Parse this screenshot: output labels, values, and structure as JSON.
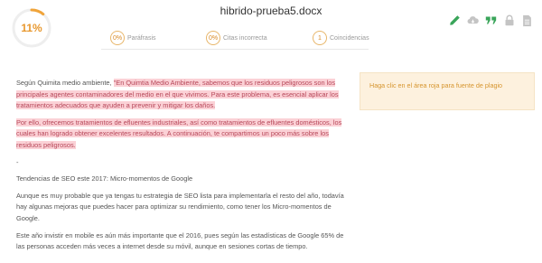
{
  "score": {
    "value": "11%",
    "ring_color": "#f0a43a",
    "fraction": 0.11
  },
  "document": {
    "title": "hibrido-prueba5.docx"
  },
  "stats": [
    {
      "value": "0%",
      "label": "Paráfrasis"
    },
    {
      "value": "0%",
      "label": "Citas incorrecta"
    },
    {
      "value": "1",
      "label": "Coincidencias"
    }
  ],
  "toolbar": {
    "icons": [
      "edit-icon",
      "cloud-download-icon",
      "quote-icon",
      "lock-icon",
      "document-icon"
    ],
    "colors": {
      "active": "#3aa55a",
      "inactive": "#c4c4c4"
    }
  },
  "side_note": {
    "text": "Haga clic en el área roja para fuente de plagio"
  },
  "body": {
    "p1_plain": "Según Quimita medio ambiente, ",
    "p1_highlight": "\"En Quimtia Medio Ambiente, sabemos que los residuos peligrosos son los principales agentes contaminadores del medio en el que vivimos. Para este problema, es esencial aplicar los tratamientos adecuados que ayuden a prevenir y mitigar los daños.",
    "p2_highlight": "Por ello, ofrecemos tratamientos de efluentes industriales, así como tratamientos de efluentes domésticos, los cuales han logrado obtener excelentes resultados. A continuación, te compartimos un poco más sobre los residuos peligrosos.",
    "p3": "-",
    "p4": "Tendencias de SEO este 2017: Micro-momentos de Google",
    "p5": "Aunque es muy probable que ya tengas tu estrategia de SEO lista para implementarla el resto del año, todavía hay algunas mejoras que puedes hacer para optimizar su rendimiento, como tener los Micro-momentos de Google.",
    "p6": "Este año invistir en mobile es aún más importante que el 2016, pues según las estadísticas de Google 65% de las personas acceden más veces a internet desde su móvil, aunque en sesiones cortas de tiempo."
  }
}
